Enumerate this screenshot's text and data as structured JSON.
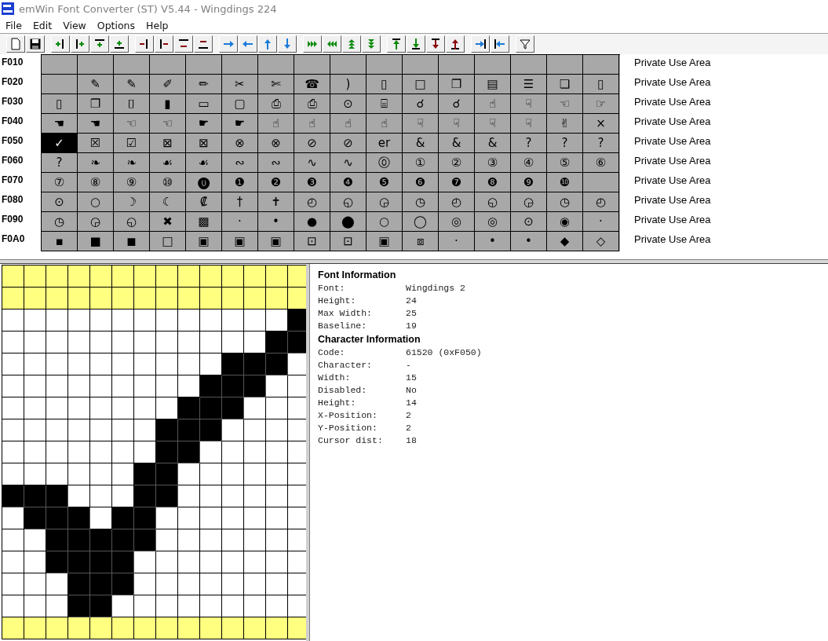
{
  "window": {
    "title": "emWin Font Converter (ST) V5.44 - Wingdings 224"
  },
  "menu": [
    "File",
    "Edit",
    "View",
    "Options",
    "Help"
  ],
  "character_table": {
    "rows": [
      {
        "code": "F010",
        "block": "Private Use Area",
        "cells": [
          {
            "selected": false
          },
          {
            "selected": false
          },
          {
            "selected": false
          },
          {
            "selected": false
          },
          {
            "selected": false
          },
          {
            "selected": false
          },
          {
            "selected": false
          },
          {
            "selected": false
          },
          {
            "selected": false
          },
          {
            "selected": false
          },
          {
            "selected": false
          },
          {
            "selected": false
          },
          {
            "selected": false
          },
          {
            "selected": false
          },
          {
            "selected": false
          },
          {
            "selected": false
          }
        ]
      },
      {
        "code": "F020",
        "block": "Private Use Area",
        "cells": [
          {
            "selected": false
          },
          {
            "glyph": "✎",
            "selected": false
          },
          {
            "glyph": "✎",
            "selected": false
          },
          {
            "glyph": "✐",
            "selected": false
          },
          {
            "glyph": "✏",
            "selected": false
          },
          {
            "glyph": "✂",
            "selected": false
          },
          {
            "glyph": "✄",
            "selected": false
          },
          {
            "glyph": "☎",
            "selected": false
          },
          {
            "glyph": ")",
            "selected": false
          },
          {
            "glyph": "▯",
            "selected": false
          },
          {
            "glyph": "□",
            "selected": false
          },
          {
            "glyph": "❐",
            "selected": false
          },
          {
            "glyph": "▤",
            "selected": false
          },
          {
            "glyph": "☰",
            "selected": false
          },
          {
            "glyph": "❏",
            "selected": false
          },
          {
            "glyph": "▯",
            "selected": false
          }
        ]
      },
      {
        "code": "F030",
        "block": "Private Use Area",
        "cells": [
          {
            "glyph": "▯",
            "selected": false
          },
          {
            "glyph": "❐",
            "selected": false
          },
          {
            "glyph": "⌷",
            "selected": false
          },
          {
            "glyph": "▮",
            "selected": false
          },
          {
            "glyph": "▭",
            "selected": false
          },
          {
            "glyph": "▢",
            "selected": false
          },
          {
            "glyph": "⎙",
            "selected": false
          },
          {
            "glyph": "⎙",
            "selected": false
          },
          {
            "glyph": "⊙",
            "selected": false
          },
          {
            "glyph": "⌸",
            "selected": false
          },
          {
            "glyph": "☌",
            "selected": false
          },
          {
            "glyph": "☌",
            "selected": false
          },
          {
            "glyph": "☝",
            "selected": false
          },
          {
            "glyph": "☟",
            "selected": false
          },
          {
            "glyph": "☜",
            "selected": false
          },
          {
            "glyph": "☞",
            "selected": false
          }
        ]
      },
      {
        "code": "F040",
        "block": "Private Use Area",
        "cells": [
          {
            "glyph": "☚",
            "selected": false
          },
          {
            "glyph": "☚",
            "selected": false
          },
          {
            "glyph": "☜",
            "selected": false
          },
          {
            "glyph": "☜",
            "selected": false
          },
          {
            "glyph": "☛",
            "selected": false
          },
          {
            "glyph": "☛",
            "selected": false
          },
          {
            "glyph": "☝",
            "selected": false
          },
          {
            "glyph": "☝",
            "selected": false
          },
          {
            "glyph": "☝",
            "selected": false
          },
          {
            "glyph": "☝",
            "selected": false
          },
          {
            "glyph": "☟",
            "selected": false
          },
          {
            "glyph": "☟",
            "selected": false
          },
          {
            "glyph": "☟",
            "selected": false
          },
          {
            "glyph": "☟",
            "selected": false
          },
          {
            "glyph": "✌",
            "selected": false
          },
          {
            "glyph": "×",
            "selected": false
          }
        ]
      },
      {
        "code": "F050",
        "block": "Private Use Area",
        "cells": [
          {
            "glyph": "✓",
            "selected": true
          },
          {
            "glyph": "☒",
            "selected": false
          },
          {
            "glyph": "☑",
            "selected": false
          },
          {
            "glyph": "⊠",
            "selected": false
          },
          {
            "glyph": "⊠",
            "selected": false
          },
          {
            "glyph": "⊗",
            "selected": false
          },
          {
            "glyph": "⊗",
            "selected": false
          },
          {
            "glyph": "⊘",
            "selected": false
          },
          {
            "glyph": "⊘",
            "selected": false
          },
          {
            "glyph": "er",
            "selected": false
          },
          {
            "glyph": "&",
            "selected": false
          },
          {
            "glyph": "&",
            "selected": false
          },
          {
            "glyph": "&",
            "selected": false
          },
          {
            "glyph": "?",
            "selected": false
          },
          {
            "glyph": "?",
            "selected": false
          },
          {
            "glyph": "?",
            "selected": false
          }
        ]
      },
      {
        "code": "F060",
        "block": "Private Use Area",
        "cells": [
          {
            "glyph": "?",
            "selected": false
          },
          {
            "glyph": "❧",
            "selected": false
          },
          {
            "glyph": "❧",
            "selected": false
          },
          {
            "glyph": "☙",
            "selected": false
          },
          {
            "glyph": "☙",
            "selected": false
          },
          {
            "glyph": "∾",
            "selected": false
          },
          {
            "glyph": "∾",
            "selected": false
          },
          {
            "glyph": "∿",
            "selected": false
          },
          {
            "glyph": "∿",
            "selected": false
          },
          {
            "glyph": "⓪",
            "selected": false
          },
          {
            "glyph": "①",
            "selected": false
          },
          {
            "glyph": "②",
            "selected": false
          },
          {
            "glyph": "③",
            "selected": false
          },
          {
            "glyph": "④",
            "selected": false
          },
          {
            "glyph": "⑤",
            "selected": false
          },
          {
            "glyph": "⑥",
            "selected": false
          }
        ]
      },
      {
        "code": "F070",
        "block": "Private Use Area",
        "cells": [
          {
            "glyph": "⑦",
            "selected": false
          },
          {
            "glyph": "⑧",
            "selected": false
          },
          {
            "glyph": "⑨",
            "selected": false
          },
          {
            "glyph": "⑩",
            "selected": false
          },
          {
            "glyph": "⓿",
            "selected": false
          },
          {
            "glyph": "❶",
            "selected": false
          },
          {
            "glyph": "❷",
            "selected": false
          },
          {
            "glyph": "❸",
            "selected": false
          },
          {
            "glyph": "❹",
            "selected": false
          },
          {
            "glyph": "❺",
            "selected": false
          },
          {
            "glyph": "❻",
            "selected": false
          },
          {
            "glyph": "❼",
            "selected": false
          },
          {
            "glyph": "❽",
            "selected": false
          },
          {
            "glyph": "❾",
            "selected": false
          },
          {
            "glyph": "❿",
            "selected": false
          },
          {
            "selected": false
          }
        ]
      },
      {
        "code": "F080",
        "block": "Private Use Area",
        "cells": [
          {
            "glyph": "⊙",
            "selected": false
          },
          {
            "glyph": "○",
            "selected": false
          },
          {
            "glyph": "☽",
            "selected": false
          },
          {
            "glyph": "☾",
            "selected": false
          },
          {
            "glyph": "₡",
            "selected": false
          },
          {
            "glyph": "†",
            "selected": false
          },
          {
            "glyph": "✝",
            "selected": false
          },
          {
            "glyph": "◴",
            "selected": false
          },
          {
            "glyph": "◵",
            "selected": false
          },
          {
            "glyph": "◶",
            "selected": false
          },
          {
            "glyph": "◷",
            "selected": false
          },
          {
            "glyph": "◴",
            "selected": false
          },
          {
            "glyph": "◵",
            "selected": false
          },
          {
            "glyph": "◶",
            "selected": false
          },
          {
            "glyph": "◷",
            "selected": false
          },
          {
            "glyph": "◴",
            "selected": false
          }
        ]
      },
      {
        "code": "F090",
        "block": "Private Use Area",
        "cells": [
          {
            "glyph": "◷",
            "selected": false
          },
          {
            "glyph": "◶",
            "selected": false
          },
          {
            "glyph": "◵",
            "selected": false
          },
          {
            "glyph": "✖",
            "selected": false
          },
          {
            "glyph": "▩",
            "selected": false
          },
          {
            "glyph": "·",
            "selected": false
          },
          {
            "glyph": "•",
            "selected": false
          },
          {
            "glyph": "●",
            "selected": false
          },
          {
            "glyph": "⬤",
            "selected": false
          },
          {
            "glyph": "○",
            "selected": false
          },
          {
            "glyph": "◯",
            "selected": false
          },
          {
            "glyph": "◎",
            "selected": false
          },
          {
            "glyph": "◎",
            "selected": false
          },
          {
            "glyph": "⊙",
            "selected": false
          },
          {
            "glyph": "◉",
            "selected": false
          },
          {
            "glyph": "·",
            "selected": false
          }
        ]
      },
      {
        "code": "F0A0",
        "block": "Private Use Area",
        "cells": [
          {
            "glyph": "▪",
            "selected": false
          },
          {
            "glyph": "■",
            "selected": false
          },
          {
            "glyph": "◼",
            "selected": false
          },
          {
            "glyph": "□",
            "selected": false
          },
          {
            "glyph": "▣",
            "selected": false
          },
          {
            "glyph": "▣",
            "selected": false
          },
          {
            "glyph": "▣",
            "selected": false
          },
          {
            "glyph": "⊡",
            "selected": false
          },
          {
            "glyph": "⊡",
            "selected": false
          },
          {
            "glyph": "▣",
            "selected": false
          },
          {
            "glyph": "⧈",
            "selected": false
          },
          {
            "glyph": "·",
            "selected": false
          },
          {
            "glyph": "•",
            "selected": false
          },
          {
            "glyph": "•",
            "selected": false
          },
          {
            "glyph": "◆",
            "selected": false
          },
          {
            "glyph": "◇",
            "selected": false
          }
        ]
      }
    ]
  },
  "bitmap": {
    "rows": [
      {
        "kind": "margin",
        "pixels": [
          false,
          false,
          false,
          false,
          false,
          false,
          false,
          false,
          false,
          false,
          false,
          false,
          false,
          false
        ]
      },
      {
        "kind": "margin",
        "pixels": [
          false,
          false,
          false,
          false,
          false,
          false,
          false,
          false,
          false,
          false,
          false,
          false,
          false,
          false
        ]
      },
      {
        "kind": "glyph",
        "pixels": [
          false,
          false,
          false,
          false,
          false,
          false,
          false,
          false,
          false,
          false,
          false,
          false,
          false,
          true
        ]
      },
      {
        "kind": "glyph",
        "pixels": [
          false,
          false,
          false,
          false,
          false,
          false,
          false,
          false,
          false,
          false,
          false,
          false,
          true,
          true
        ]
      },
      {
        "kind": "glyph",
        "pixels": [
          false,
          false,
          false,
          false,
          false,
          false,
          false,
          false,
          false,
          false,
          true,
          true,
          true,
          false
        ]
      },
      {
        "kind": "glyph",
        "pixels": [
          false,
          false,
          false,
          false,
          false,
          false,
          false,
          false,
          false,
          true,
          true,
          true,
          false,
          false
        ]
      },
      {
        "kind": "glyph",
        "pixels": [
          false,
          false,
          false,
          false,
          false,
          false,
          false,
          false,
          true,
          true,
          true,
          false,
          false,
          false
        ]
      },
      {
        "kind": "glyph",
        "pixels": [
          false,
          false,
          false,
          false,
          false,
          false,
          false,
          true,
          true,
          true,
          false,
          false,
          false,
          false
        ]
      },
      {
        "kind": "glyph",
        "pixels": [
          false,
          false,
          false,
          false,
          false,
          false,
          false,
          true,
          true,
          false,
          false,
          false,
          false,
          false
        ]
      },
      {
        "kind": "glyph",
        "pixels": [
          false,
          false,
          false,
          false,
          false,
          false,
          true,
          true,
          false,
          false,
          false,
          false,
          false,
          false
        ]
      },
      {
        "kind": "glyph",
        "pixels": [
          true,
          true,
          true,
          false,
          false,
          false,
          true,
          true,
          false,
          false,
          false,
          false,
          false,
          false
        ]
      },
      {
        "kind": "glyph",
        "pixels": [
          false,
          true,
          true,
          true,
          false,
          true,
          true,
          false,
          false,
          false,
          false,
          false,
          false,
          false
        ]
      },
      {
        "kind": "glyph",
        "pixels": [
          false,
          false,
          true,
          true,
          true,
          true,
          true,
          false,
          false,
          false,
          false,
          false,
          false,
          false
        ]
      },
      {
        "kind": "glyph",
        "pixels": [
          false,
          false,
          true,
          true,
          true,
          true,
          false,
          false,
          false,
          false,
          false,
          false,
          false,
          false
        ]
      },
      {
        "kind": "glyph",
        "pixels": [
          false,
          false,
          false,
          true,
          true,
          true,
          false,
          false,
          false,
          false,
          false,
          false,
          false,
          false
        ]
      },
      {
        "kind": "glyph",
        "pixels": [
          false,
          false,
          false,
          true,
          true,
          false,
          false,
          false,
          false,
          false,
          false,
          false,
          false,
          false
        ]
      },
      {
        "kind": "margin",
        "pixels": [
          false,
          false,
          false,
          false,
          false,
          false,
          false,
          false,
          false,
          false,
          false,
          false,
          false,
          false
        ]
      }
    ]
  },
  "info": [
    {
      "title": "Font Information",
      "fields": [
        {
          "label": "Font:",
          "value": "Wingdings 2"
        },
        {
          "label": "Height:",
          "value": "24"
        },
        {
          "label": "Max Width:",
          "value": "25"
        },
        {
          "label": "Baseline:",
          "value": "19"
        }
      ]
    },
    {
      "title": "Character Information",
      "fields": [
        {
          "label": "Code:",
          "value": "61520 (0xF050)"
        },
        {
          "label": "Character:",
          "value": "-"
        },
        {
          "label": "Width:",
          "value": "15"
        },
        {
          "label": "Disabled:",
          "value": "No"
        },
        {
          "label": "Height:",
          "value": "14"
        },
        {
          "label": "X-Position:",
          "value": "2"
        },
        {
          "label": "Y-Position:",
          "value": "2"
        },
        {
          "label": "Cursor dist:",
          "value": "18"
        }
      ]
    }
  ]
}
